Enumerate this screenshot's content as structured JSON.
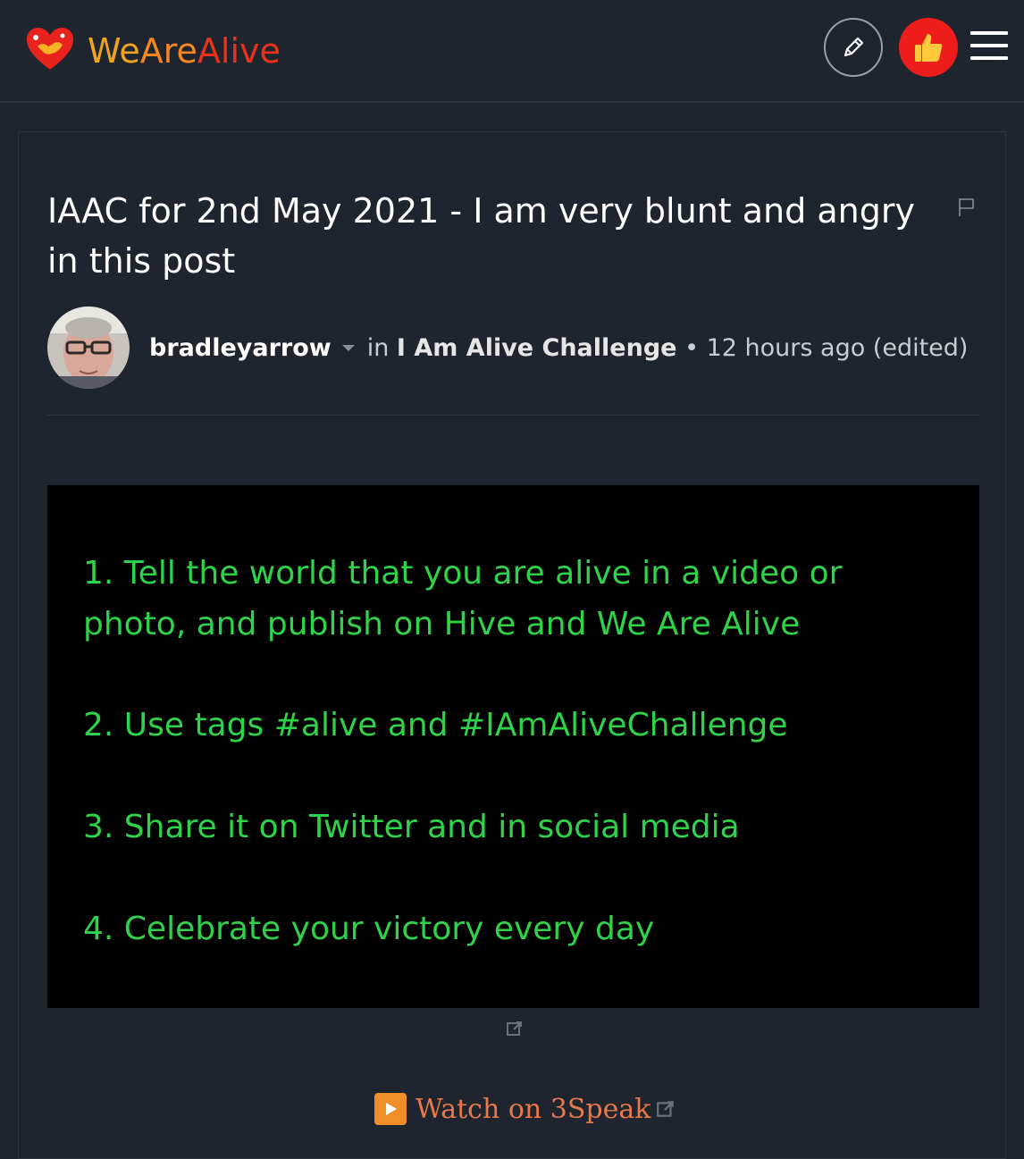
{
  "header": {
    "logo": {
      "we": "We",
      "are": "Are",
      "alive": "Alive"
    },
    "icons": {
      "edit": "pencil-icon",
      "like": "thumbs-up-icon",
      "menu": "hamburger-menu-icon"
    },
    "colors": {
      "background": "#1f252e",
      "like_button": "#ef1c1c",
      "logo_we": "#f0a31f",
      "logo_are": "#f6861f",
      "logo_alive": "#e8321c"
    }
  },
  "post": {
    "title": "IAAC for 2nd May 2021 - I am very blunt and angry in this post",
    "author": "bradleyarrow",
    "in_label": "in",
    "community": "I Am Alive Challenge",
    "separator": "•",
    "timestamp": "12 hours ago (edited)",
    "rules": [
      "1. Tell the world that you are alive in a video or photo, and publish on Hive and We Are Alive",
      "2. Use tags #alive and #IAmAliveChallenge",
      "3. Share it on Twitter and in social media",
      "4. Celebrate your victory every day"
    ],
    "rules_color": "#2ed34a",
    "watch_label": "Watch on 3Speak",
    "watch_color": "#e8784a"
  }
}
